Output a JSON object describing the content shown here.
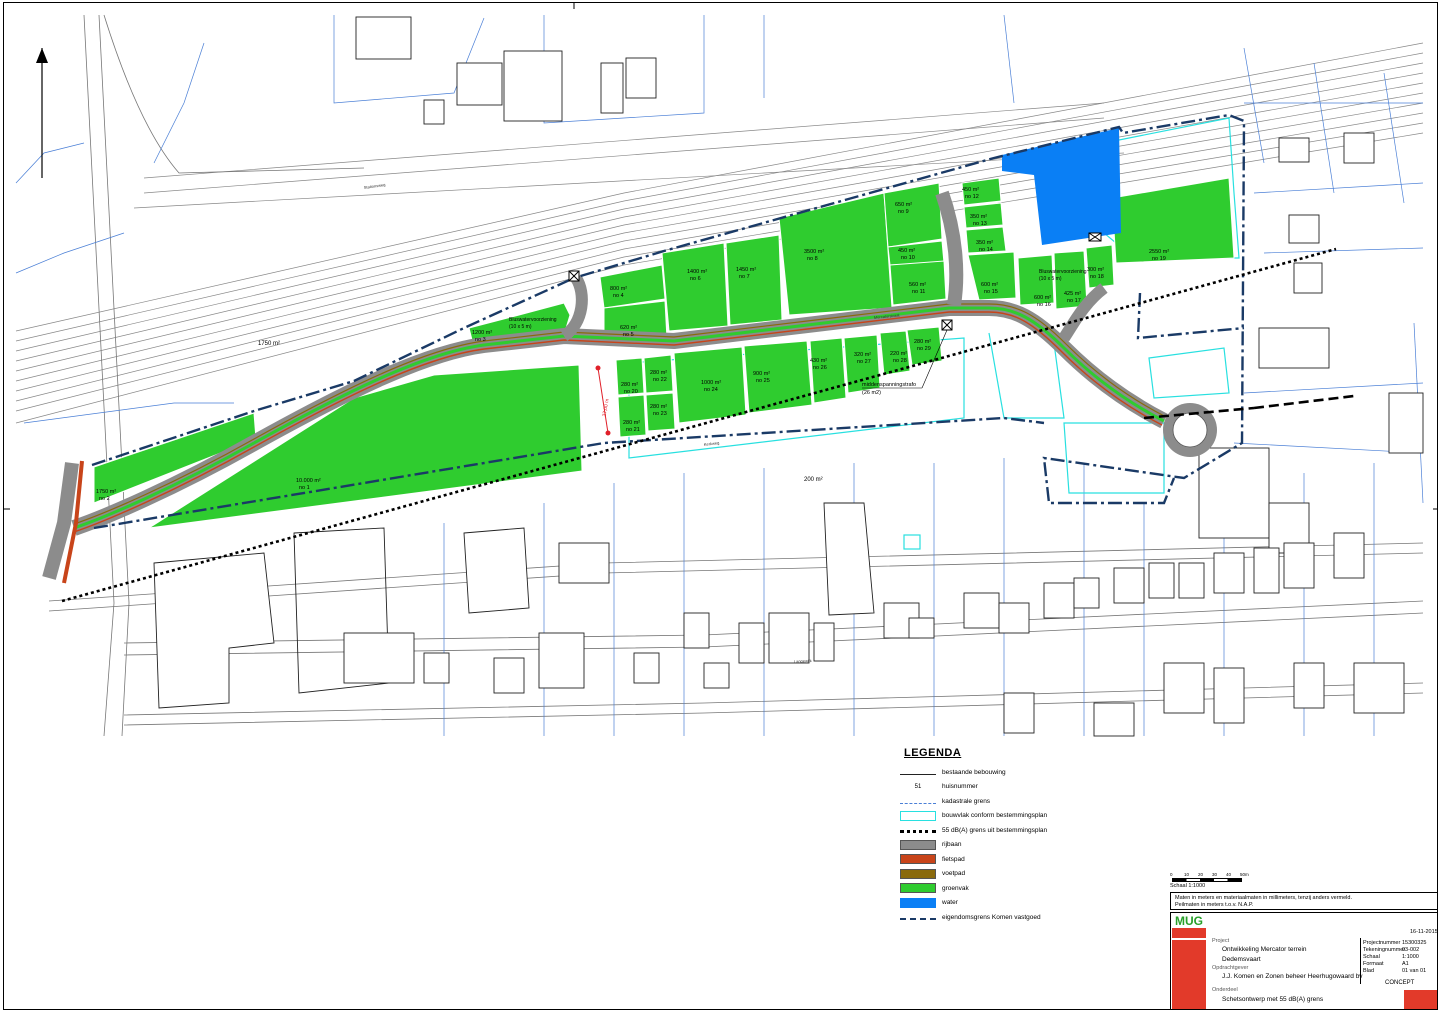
{
  "map": {
    "area_label": "1750 m²",
    "distance_label": "37,00 m",
    "trafo_label_1": "middenspanningstrafo",
    "trafo_label_2": "(26 m2)",
    "buffer_label_1": "Bluswatervoorziening",
    "buffer_label_1b": "(10 x 5 m)",
    "buffer_label_2": "Bluswatervoorziening",
    "buffer_label_2b": "(10 x 5 m)",
    "area_200": "200 m²",
    "street_1": "Mercatorstraat",
    "street_2": "Kerkweg",
    "street_3": "Langewijk",
    "street_4": "Stationsweg",
    "plots": [
      {
        "area": "1750 m²",
        "no": "no 2"
      },
      {
        "area": "10.000 m²",
        "no": "no 1"
      },
      {
        "area": "1200 m²",
        "no": "no 3"
      },
      {
        "area": "800 m²",
        "no": "no 4"
      },
      {
        "area": "620 m²",
        "no": "no 5"
      },
      {
        "area": "1400 m²",
        "no": "no 6"
      },
      {
        "area": "1450 m²",
        "no": "no 7"
      },
      {
        "area": "3500 m²",
        "no": "no 8"
      },
      {
        "area": "650 m²",
        "no": "no 9"
      },
      {
        "area": "450 m²",
        "no": "no 10"
      },
      {
        "area": "560 m²",
        "no": "no 11"
      },
      {
        "area": "450 m²",
        "no": "no 12"
      },
      {
        "area": "350 m²",
        "no": "no 13"
      },
      {
        "area": "350 m²",
        "no": "no 14"
      },
      {
        "area": "600 m²",
        "no": "no 15"
      },
      {
        "area": "600 m²",
        "no": "no 16"
      },
      {
        "area": "425 m²",
        "no": "no 17"
      },
      {
        "area": "300 m²",
        "no": "no 18"
      },
      {
        "area": "2550 m²",
        "no": "no 19"
      },
      {
        "area": "280 m²",
        "no": "no 20"
      },
      {
        "area": "280 m²",
        "no": "no 21"
      },
      {
        "area": "280 m²",
        "no": "no 22"
      },
      {
        "area": "280 m²",
        "no": "no 23"
      },
      {
        "area": "1000 m²",
        "no": "no 24"
      },
      {
        "area": "900 m²",
        "no": "no 25"
      },
      {
        "area": "430 m²",
        "no": "no 26"
      },
      {
        "area": "320 m²",
        "no": "no 27"
      },
      {
        "area": "220 m²",
        "no": "no 28"
      },
      {
        "area": "280 m²",
        "no": "no 29"
      }
    ]
  },
  "legend": {
    "title": "LEGENDA",
    "items": [
      {
        "label": "bestaande bebouwing"
      },
      {
        "label": "huisnummer",
        "code": "51"
      },
      {
        "label": "kadastrale grens"
      },
      {
        "label": "bouwvlak conform bestemmingsplan"
      },
      {
        "label": "55 dB(A) grens uit bestemmingsplan"
      },
      {
        "label": "rijbaan"
      },
      {
        "label": "fietspad"
      },
      {
        "label": "voetpad"
      },
      {
        "label": "groenvak"
      },
      {
        "label": "water"
      },
      {
        "label": "eigendomsgrens Komen vastgoed"
      }
    ]
  },
  "titleblock": {
    "scale_label": "Schaal 1:1000",
    "scale_ticks": [
      "0",
      "10",
      "20",
      "30",
      "40",
      "50m"
    ],
    "note_1": "Maten in meters en materiaalmaten in millimeters, tenzij anders vermeld.",
    "note_2": "Peilmaten in meters t.o.v. N.A.P.",
    "logo": "MUG",
    "project_head": "Project",
    "project_1": "Ontwikkeling Mercator terrein",
    "project_2": "Dedemsvaart",
    "client_head": "Opdrachtgever",
    "client": "J.J. Komen en Zonen beheer Heerhugowaard bv",
    "subject_head": "Onderdeel",
    "subject": "Schetsontwerp met 55 dB(A) grens",
    "scale": "1:1000",
    "status": "CONCEPT",
    "projnr_label": "Projectnummer",
    "projnr": "15300325",
    "tek_label": "Tekeningnummer",
    "tek": "03-002",
    "schaal_label": "Schaal",
    "formaat_label": "Formaat",
    "formaat": "A1",
    "blad_label": "Blad",
    "blad": "01 van 01",
    "date": "16-11-2015"
  },
  "colors": {
    "green": "#2fcc2f",
    "water": "#0a7ff5",
    "road": "#8c8c8c",
    "bike": "#c8441a",
    "foot": "#8a6a0c",
    "cyan": "#28e0e0",
    "cadastral": "#4a7fd6",
    "building": "#222222"
  }
}
